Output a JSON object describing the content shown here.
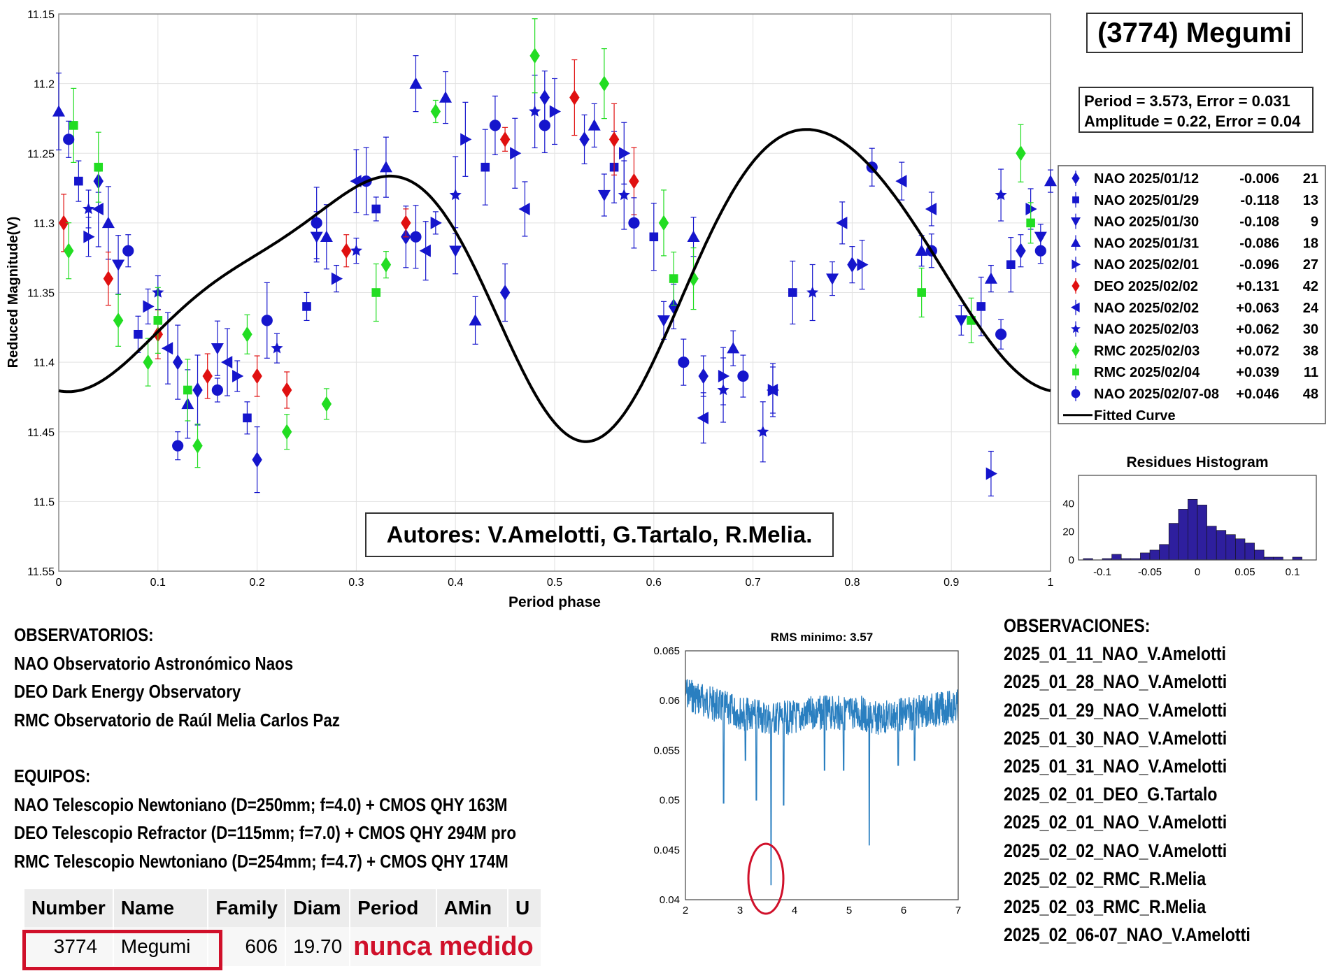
{
  "chart_data": [
    {
      "type": "scatter",
      "title": "(3774) Megumi",
      "xlabel": "Period phase",
      "ylabel": "Reduced Magnitude(V)",
      "xlim": [
        0,
        1
      ],
      "ylim": [
        11.15,
        11.55
      ],
      "y_reversed": true,
      "xticks": [
        "0",
        "0.1",
        "0.2",
        "0.3",
        "0.4",
        "0.5",
        "0.6",
        "0.7",
        "0.8",
        "0.9",
        "1"
      ],
      "yticks": [
        "11.15",
        "11.2",
        "11.25",
        "11.3",
        "11.35",
        "11.4",
        "11.45",
        "11.5",
        "11.55"
      ],
      "grid": true,
      "legend_position": "right",
      "annotation_period": "Period =  3.573, Error = 0.031",
      "annotation_amplitude": "Amplitude = 0.22, Error = 0.04",
      "annotation_authors": "Autores: V.Amelotti, G.Tartalo, R.Melia.",
      "series": [
        {
          "name": "NAO 2025/01/12",
          "offset": "-0.006",
          "count": "21",
          "marker": "diamond",
          "color": "#1515cc",
          "points": [
            [
              0.04,
              11.27
            ],
            [
              0.12,
              11.4
            ],
            [
              0.14,
              11.42
            ],
            [
              0.2,
              11.47
            ],
            [
              0.35,
              11.31
            ],
            [
              0.45,
              11.35
            ],
            [
              0.49,
              11.21
            ],
            [
              0.53,
              11.24
            ],
            [
              0.62,
              11.36
            ],
            [
              0.65,
              11.41
            ],
            [
              0.8,
              11.33
            ],
            [
              0.97,
              11.32
            ]
          ]
        },
        {
          "name": "NAO 2025/01/29",
          "offset": "-0.118",
          "count": "13",
          "marker": "square",
          "color": "#1515cc",
          "points": [
            [
              0.02,
              11.27
            ],
            [
              0.08,
              11.38
            ],
            [
              0.19,
              11.44
            ],
            [
              0.25,
              11.36
            ],
            [
              0.32,
              11.29
            ],
            [
              0.43,
              11.26
            ],
            [
              0.56,
              11.26
            ],
            [
              0.6,
              11.31
            ],
            [
              0.74,
              11.35
            ],
            [
              0.93,
              11.36
            ],
            [
              0.96,
              11.33
            ]
          ]
        },
        {
          "name": "NAO 2025/01/30",
          "offset": "-0.108",
          "count": "9",
          "marker": "triangle-down",
          "color": "#1515cc",
          "points": [
            [
              0.06,
              11.33
            ],
            [
              0.16,
              11.39
            ],
            [
              0.26,
              11.31
            ],
            [
              0.4,
              11.32
            ],
            [
              0.55,
              11.28
            ],
            [
              0.61,
              11.37
            ],
            [
              0.78,
              11.34
            ],
            [
              0.91,
              11.37
            ],
            [
              0.99,
              11.31
            ]
          ]
        },
        {
          "name": "NAO 2025/01/31",
          "offset": "-0.086",
          "count": "18",
          "marker": "triangle-up",
          "color": "#1515cc",
          "points": [
            [
              0.0,
              11.22
            ],
            [
              0.05,
              11.3
            ],
            [
              0.13,
              11.43
            ],
            [
              0.27,
              11.31
            ],
            [
              0.33,
              11.26
            ],
            [
              0.36,
              11.2
            ],
            [
              0.39,
              11.21
            ],
            [
              0.42,
              11.37
            ],
            [
              0.54,
              11.23
            ],
            [
              0.64,
              11.31
            ],
            [
              0.68,
              11.39
            ],
            [
              0.87,
              11.32
            ],
            [
              0.94,
              11.34
            ],
            [
              1.0,
              11.27
            ]
          ]
        },
        {
          "name": "NAO 2025/02/01",
          "offset": "-0.096",
          "count": "27",
          "marker": "triangle-right",
          "color": "#1515cc",
          "points": [
            [
              0.03,
              11.31
            ],
            [
              0.09,
              11.36
            ],
            [
              0.18,
              11.41
            ],
            [
              0.28,
              11.34
            ],
            [
              0.38,
              11.3
            ],
            [
              0.41,
              11.24
            ],
            [
              0.46,
              11.25
            ],
            [
              0.5,
              11.22
            ],
            [
              0.57,
              11.25
            ],
            [
              0.67,
              11.41
            ],
            [
              0.72,
              11.42
            ],
            [
              0.81,
              11.33
            ],
            [
              0.94,
              11.48
            ],
            [
              0.98,
              11.29
            ]
          ]
        },
        {
          "name": "DEO 2025/02/02",
          "offset": "+0.131",
          "count": "42",
          "marker": "diamond",
          "color": "#e01010",
          "points": [
            [
              0.005,
              11.3
            ],
            [
              0.05,
              11.34
            ],
            [
              0.1,
              11.38
            ],
            [
              0.15,
              11.41
            ],
            [
              0.2,
              11.41
            ],
            [
              0.23,
              11.42
            ],
            [
              0.29,
              11.32
            ],
            [
              0.35,
              11.3
            ],
            [
              0.45,
              11.24
            ],
            [
              0.52,
              11.21
            ],
            [
              0.56,
              11.24
            ],
            [
              0.58,
              11.27
            ]
          ]
        },
        {
          "name": "NAO 2025/02/02",
          "offset": "+0.063",
          "count": "24",
          "marker": "triangle-left",
          "color": "#1515cc",
          "points": [
            [
              0.04,
              11.29
            ],
            [
              0.11,
              11.39
            ],
            [
              0.17,
              11.4
            ],
            [
              0.3,
              11.27
            ],
            [
              0.37,
              11.32
            ],
            [
              0.47,
              11.29
            ],
            [
              0.65,
              11.44
            ],
            [
              0.72,
              11.42
            ],
            [
              0.79,
              11.3
            ],
            [
              0.85,
              11.27
            ],
            [
              0.88,
              11.29
            ]
          ]
        },
        {
          "name": "NAO 2025/02/03",
          "offset": "+0.062",
          "count": "30",
          "marker": "star",
          "color": "#1515cc",
          "points": [
            [
              0.03,
              11.29
            ],
            [
              0.1,
              11.35
            ],
            [
              0.22,
              11.39
            ],
            [
              0.3,
              11.32
            ],
            [
              0.4,
              11.28
            ],
            [
              0.48,
              11.22
            ],
            [
              0.57,
              11.28
            ],
            [
              0.67,
              11.42
            ],
            [
              0.71,
              11.45
            ],
            [
              0.76,
              11.35
            ],
            [
              0.95,
              11.28
            ]
          ]
        },
        {
          "name": "RMC 2025/02/03",
          "offset": "+0.072",
          "count": "38",
          "marker": "diamond",
          "color": "#22dd22",
          "points": [
            [
              0.01,
              11.32
            ],
            [
              0.06,
              11.37
            ],
            [
              0.09,
              11.4
            ],
            [
              0.14,
              11.46
            ],
            [
              0.19,
              11.38
            ],
            [
              0.23,
              11.45
            ],
            [
              0.27,
              11.43
            ],
            [
              0.33,
              11.33
            ],
            [
              0.38,
              11.22
            ],
            [
              0.48,
              11.18
            ],
            [
              0.55,
              11.2
            ],
            [
              0.61,
              11.3
            ],
            [
              0.64,
              11.34
            ],
            [
              0.97,
              11.25
            ]
          ]
        },
        {
          "name": "RMC 2025/02/04",
          "offset": "+0.039",
          "count": "11",
          "marker": "square",
          "color": "#22dd22",
          "points": [
            [
              0.015,
              11.23
            ],
            [
              0.04,
              11.26
            ],
            [
              0.1,
              11.37
            ],
            [
              0.13,
              11.42
            ],
            [
              0.32,
              11.35
            ],
            [
              0.62,
              11.34
            ],
            [
              0.87,
              11.35
            ],
            [
              0.92,
              11.37
            ],
            [
              0.98,
              11.3
            ]
          ]
        },
        {
          "name": "NAO 2025/02/07-08",
          "offset": "+0.046",
          "count": "48",
          "marker": "circle",
          "color": "#1515cc",
          "points": [
            [
              0.01,
              11.24
            ],
            [
              0.07,
              11.32
            ],
            [
              0.12,
              11.46
            ],
            [
              0.16,
              11.42
            ],
            [
              0.21,
              11.37
            ],
            [
              0.26,
              11.3
            ],
            [
              0.31,
              11.27
            ],
            [
              0.36,
              11.31
            ],
            [
              0.44,
              11.23
            ],
            [
              0.49,
              11.23
            ],
            [
              0.58,
              11.3
            ],
            [
              0.63,
              11.4
            ],
            [
              0.69,
              11.41
            ],
            [
              0.82,
              11.26
            ],
            [
              0.88,
              11.32
            ],
            [
              0.95,
              11.38
            ],
            [
              0.99,
              11.32
            ]
          ]
        }
      ],
      "fitted_curve_label": "Fitted Curve"
    },
    {
      "type": "bar",
      "title": "Residues Histogram",
      "xticks": [
        "-0.1",
        "-0.05",
        "0",
        "0.05",
        "0.1"
      ],
      "yticks": [
        "0",
        "20",
        "40"
      ],
      "xlim": [
        -0.125,
        0.125
      ],
      "ylim": [
        0,
        60
      ],
      "bin_centers": [
        -0.115,
        -0.105,
        -0.095,
        -0.085,
        -0.075,
        -0.065,
        -0.055,
        -0.045,
        -0.035,
        -0.025,
        -0.015,
        -0.005,
        0.005,
        0.015,
        0.025,
        0.035,
        0.045,
        0.055,
        0.065,
        0.075,
        0.085,
        0.095,
        0.105
      ],
      "values": [
        1,
        0,
        1,
        4,
        1,
        1,
        5,
        7,
        11,
        26,
        36,
        43,
        39,
        24,
        21,
        18,
        15,
        12,
        7,
        2,
        2,
        0,
        2
      ]
    },
    {
      "type": "line",
      "title": "RMS minimo: 3.57",
      "xlim": [
        2,
        7
      ],
      "ylim": [
        0.04,
        0.065
      ],
      "xticks": [
        "2",
        "3",
        "4",
        "5",
        "6",
        "7"
      ],
      "yticks": [
        "0.04",
        "0.045",
        "0.05",
        "0.055",
        "0.06",
        "0.065"
      ],
      "minimum_x": 3.57,
      "minimum_y": 0.0415
    }
  ],
  "observatorios": {
    "heading": "OBSERVATORIOS:",
    "items": [
      "NAO Observatorio Astronómico Naos",
      "DEO Dark Energy Observatory",
      "RMC Observatorio de Raúl Melia Carlos Paz"
    ]
  },
  "equipos": {
    "heading": "EQUIPOS:",
    "items": [
      "NAO Telescopio Newtoniano (D=250mm; f=4.0) + CMOS QHY 163M",
      "DEO Telescopio Refractor (D=115mm; f=7.0) + CMOS QHY 294M pro",
      "RMC Telescopio Newtoniano (D=254mm; f=4.7) + CMOS QHY 174M"
    ]
  },
  "observaciones": {
    "heading": "OBSERVACIONES:",
    "items": [
      "2025_01_11_NAO_V.Amelotti",
      "2025_01_28_NAO_V.Amelotti",
      "2025_01_29_NAO_V.Amelotti",
      "2025_01_30_NAO_V.Amelotti",
      "2025_01_31_NAO_V.Amelotti",
      "2025_02_01_DEO_G.Tartalo",
      "2025_02_01_NAO_V.Amelotti",
      "2025_02_02_NAO_V.Amelotti",
      "2025_02_02_RMC_R.Melia",
      "2025_02_03_RMC_R.Melia",
      "2025_02_06-07_NAO_V.Amelotti"
    ]
  },
  "table": {
    "headers": [
      "Number",
      "Name",
      "Family",
      "Diam",
      "Period",
      "AMin",
      "U"
    ],
    "row": {
      "number": "3774",
      "name": "Megumi",
      "family": "606",
      "diam": "19.70",
      "status": "nunca medido"
    }
  },
  "colors": {
    "nao": "#1515cc",
    "deo": "#e01010",
    "rmc": "#22dd22",
    "fit": "#000000",
    "hist": "#2e1f9e",
    "rms": "#2a7fc0",
    "highlight": "#d0102a"
  }
}
